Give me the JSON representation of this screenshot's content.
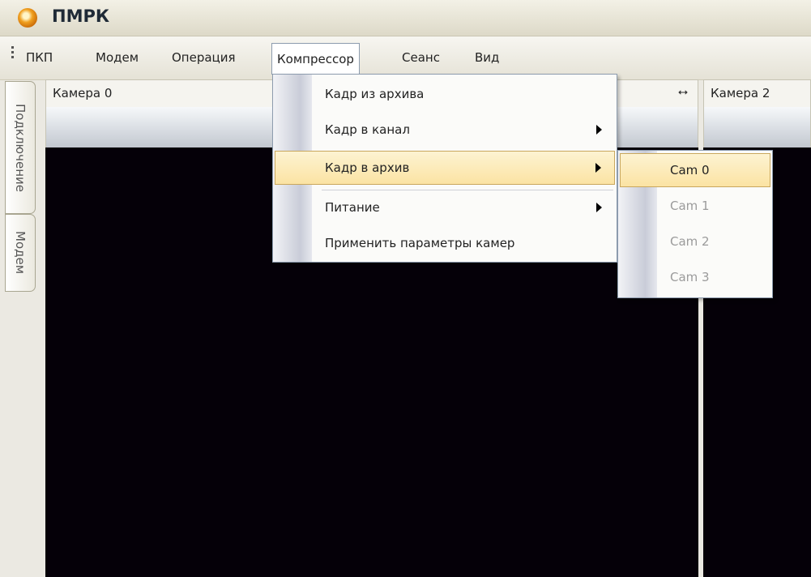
{
  "window": {
    "title": "ПМРК"
  },
  "menubar": {
    "items": [
      {
        "label": "ПКП"
      },
      {
        "label": "Модем"
      },
      {
        "label": "Операция"
      },
      {
        "label": "Компрессор"
      },
      {
        "label": "Сеанс"
      },
      {
        "label": "Вид"
      }
    ],
    "open_item": "Компрессор"
  },
  "side_tabs": [
    {
      "label": "Подключение"
    },
    {
      "label": "Модем"
    }
  ],
  "panels": [
    {
      "title": "Камера 0"
    },
    {
      "title": "Камера 2"
    }
  ],
  "compressor_menu": {
    "items": [
      {
        "label": "Кадр из архива",
        "has_submenu": false
      },
      {
        "label": "Кадр в канал",
        "has_submenu": true
      },
      {
        "label": "Кадр в архив",
        "has_submenu": true,
        "highlighted": true
      },
      {
        "label": "Питание",
        "has_submenu": true
      },
      {
        "label": "Применить параметры камер",
        "has_submenu": false
      }
    ]
  },
  "archive_submenu": {
    "items": [
      {
        "label": "Cam 0",
        "enabled": true,
        "highlighted": true
      },
      {
        "label": "Cam 1",
        "enabled": false
      },
      {
        "label": "Cam 2",
        "enabled": false
      },
      {
        "label": "Cam 3",
        "enabled": false
      }
    ]
  },
  "colors": {
    "video_background": "#050008",
    "highlight": "#fbe3a3",
    "menu_border": "#8d9cae"
  }
}
